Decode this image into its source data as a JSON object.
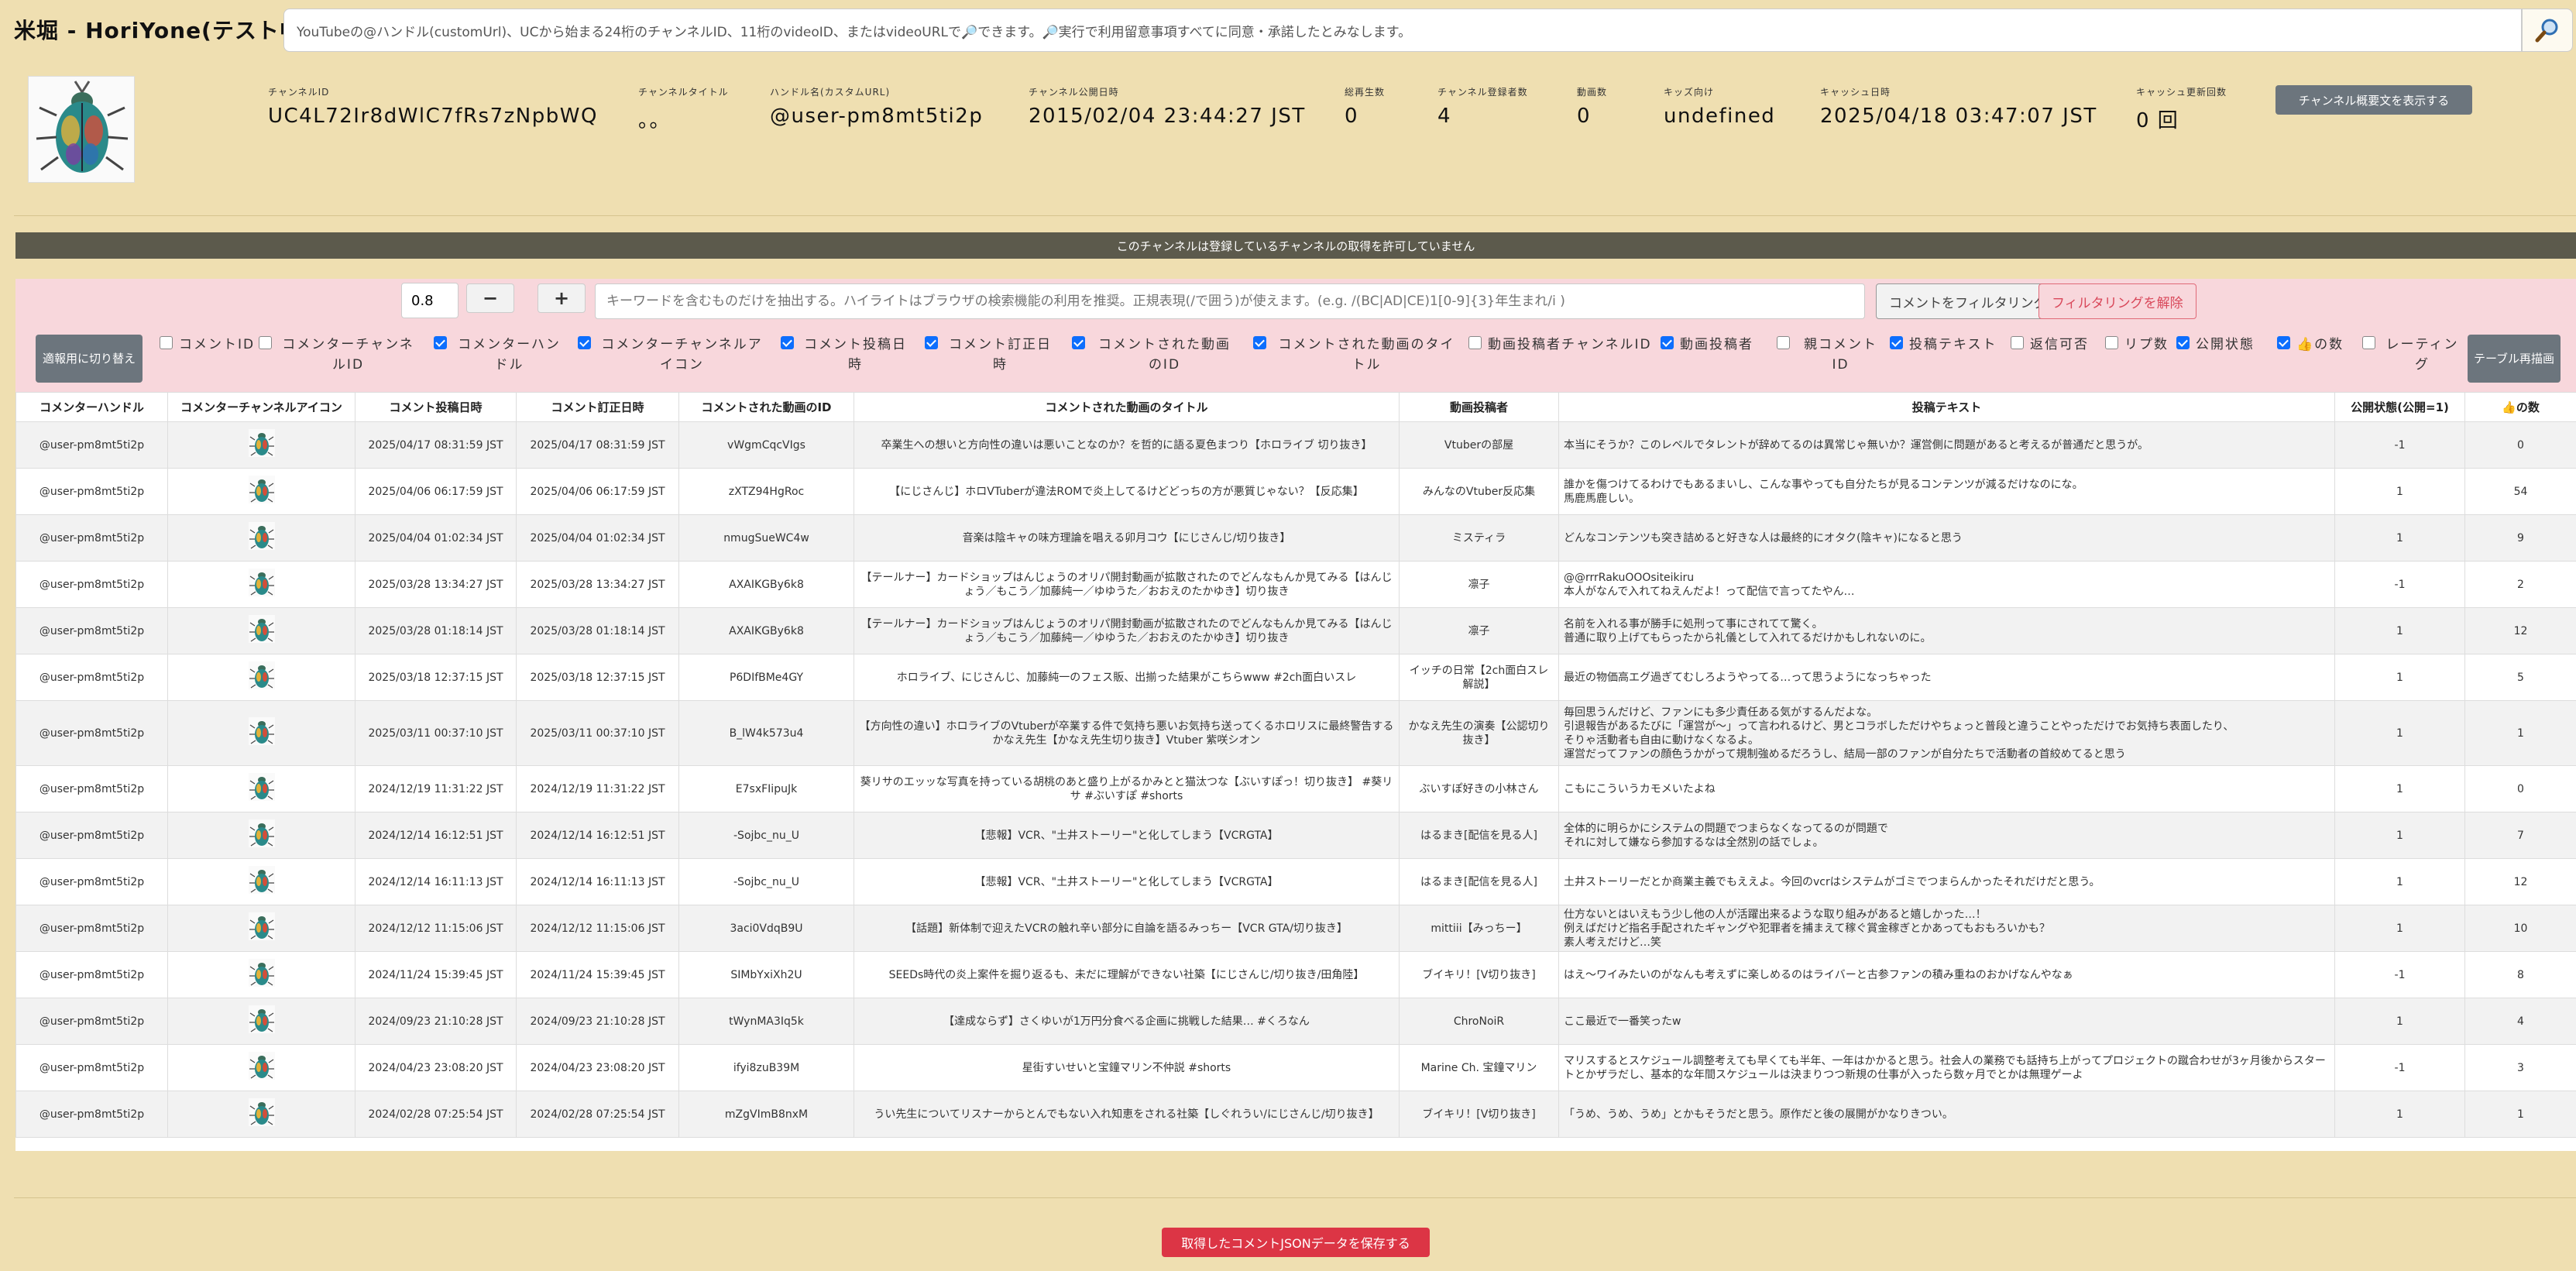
{
  "app": {
    "title": "米堀 - HoriYone(テスト中)"
  },
  "search": {
    "value": "YouTubeの@ハンドル(customUrl)、UCから始まる24桁のチャンネルID、11桁のvideoID、またはvideoURLで🔎できます。🔎実行で利用留意事項すべてに同意・承諾したとみなします。",
    "button_icon": "search-icon"
  },
  "channel": {
    "fields": [
      {
        "label": "チャンネルID",
        "value": "UC4L72Ir8dWlC7fRs7zNpbWQ"
      },
      {
        "label": "チャンネルタイトル",
        "value": "。。"
      },
      {
        "label": "ハンドル名(カスタムURL)",
        "value": "@user-pm8mt5ti2p"
      },
      {
        "label": "チャンネル公開日時",
        "value": "2015/02/04 23:44:27 JST"
      },
      {
        "label": "総再生数",
        "value": "0"
      },
      {
        "label": "チャンネル登録者数",
        "value": "4"
      },
      {
        "label": "動画数",
        "value": "0"
      },
      {
        "label": "キッズ向け",
        "value": "undefined"
      },
      {
        "label": "キャッシュ日時",
        "value": "2025/04/18 03:47:07 JST"
      },
      {
        "label": "キャッシュ更新回数",
        "value": "0 回"
      }
    ],
    "description_button": "チャンネル概要文を表示する"
  },
  "notice": "このチャンネルは登録しているチャンネルの取得を許可していません",
  "filter": {
    "threshold": "0.8",
    "minus_label": "−",
    "plus_label": "+",
    "keyword_placeholder": "キーワードを含むものだけを抽出する。ハイライトはブラウザの検索機能の利用を推奨。正規表現(/で囲う)が使えます。(e.g. /(BC|AD|CE)1[0-9]{3}年生まれ/i )",
    "filter_button": "コメントをフィルタリング",
    "clear_button": "フィルタリングを解除"
  },
  "controls": {
    "switch_button": "適報用に切り替え",
    "redraw_button": "テーブル再描画",
    "toggles": [
      {
        "label": "コメントID",
        "checked": false
      },
      {
        "label": "コメンターチャンネルID",
        "checked": false
      },
      {
        "label": "コメンターハンドル",
        "checked": true
      },
      {
        "label": "コメンターチャンネルアイコン",
        "checked": true
      },
      {
        "label": "コメント投稿日時",
        "checked": true
      },
      {
        "label": "コメント訂正日時",
        "checked": true
      },
      {
        "label": "コメントされた動画のID",
        "checked": true
      },
      {
        "label": "コメントされた動画のタイトル",
        "checked": true
      },
      {
        "label": "動画投稿者チャンネルID",
        "checked": false
      },
      {
        "label": "動画投稿者",
        "checked": true
      },
      {
        "label": "親コメントID",
        "checked": false
      },
      {
        "label": "投稿テキスト",
        "checked": true
      },
      {
        "label": "返信可否",
        "checked": false
      },
      {
        "label": "リプ数",
        "checked": false
      },
      {
        "label": "公開状態",
        "checked": true
      },
      {
        "label": "👍の数",
        "checked": true
      },
      {
        "label": "レーティング",
        "checked": false
      }
    ]
  },
  "table": {
    "headers": [
      "コメンターハンドル",
      "コメンターチャンネルアイコン",
      "コメント投稿日時",
      "コメント訂正日時",
      "コメントされた動画のID",
      "コメントされた動画のタイトル",
      "動画投稿者",
      "投稿テキスト",
      "公開状態(公開=1)",
      "👍の数"
    ],
    "rows": [
      {
        "handle": "@user-pm8mt5ti2p",
        "posted": "2025/04/17 08:31:59 JST",
        "edited": "2025/04/17 08:31:59 JST",
        "video_id": "vWgmCqcVIgs",
        "title": "卒業生への想いと方向性の違いは悪いことなのか？を哲的に語る夏色まつり【ホロライブ 切り抜き】",
        "uploader": "Vtuberの部屋",
        "text": "本当にそうか？このレベルでタレントが辞めてるのは異常じゃ無いか？運営側に問題があると考えるが普通だと思うが。",
        "status": "-1",
        "likes": "0"
      },
      {
        "handle": "@user-pm8mt5ti2p",
        "posted": "2025/04/06 06:17:59 JST",
        "edited": "2025/04/06 06:17:59 JST",
        "video_id": "zXTZ94HgRoc",
        "title": "【にじさんじ】ホロVTuberが違法ROMで炎上してるけどどっちの方が悪質じゃない？【反応集】",
        "uploader": "みんなのVtuber反応集",
        "text": "誰かを傷つけてるわけでもあるまいし、こんな事やっても自分たちが見るコンテンツが減るだけなのにな。\n馬鹿馬鹿しい。",
        "status": "1",
        "likes": "54"
      },
      {
        "handle": "@user-pm8mt5ti2p",
        "posted": "2025/04/04 01:02:34 JST",
        "edited": "2025/04/04 01:02:34 JST",
        "video_id": "nmugSueWC4w",
        "title": "音楽は陰キャの味方理論を唱える卯月コウ【にじさんじ/切り抜き】",
        "uploader": "ミスティラ",
        "text": "どんなコンテンツも突き詰めると好きな人は最終的にオタク(陰キャ)になると思う",
        "status": "1",
        "likes": "9"
      },
      {
        "handle": "@user-pm8mt5ti2p",
        "posted": "2025/03/28 13:34:27 JST",
        "edited": "2025/03/28 13:34:27 JST",
        "video_id": "AXAIKGBy6k8",
        "title": "【テールナー】カードショップはんじょうのオリパ開封動画が拡散されたのでどんなもんか見てみる【はんじょう／もこう／加藤純一／ゆゆうた／おおえのたかゆき】切り抜き",
        "uploader": "凛子",
        "text": "@@rrrRakuOOOsiteikiru\n本人がなんで入れてねえんだよ！って配信で言ってたやん…",
        "status": "-1",
        "likes": "2"
      },
      {
        "handle": "@user-pm8mt5ti2p",
        "posted": "2025/03/28 01:18:14 JST",
        "edited": "2025/03/28 01:18:14 JST",
        "video_id": "AXAIKGBy6k8",
        "title": "【テールナー】カードショップはんじょうのオリパ開封動画が拡散されたのでどんなもんか見てみる【はんじょう／もこう／加藤純一／ゆゆうた／おおえのたかゆき】切り抜き",
        "uploader": "凛子",
        "text": "名前を入れる事が勝手に処刑って事にされてて驚く。\n普通に取り上げてもらったから礼儀として入れてるだけかもしれないのに。",
        "status": "1",
        "likes": "12"
      },
      {
        "handle": "@user-pm8mt5ti2p",
        "posted": "2025/03/18 12:37:15 JST",
        "edited": "2025/03/18 12:37:15 JST",
        "video_id": "P6DIfBMe4GY",
        "title": "ホロライブ、にじさんじ、加藤純一のフェス販、出揃った結果がこちらwww #2ch面白いスレ",
        "uploader": "イッチの日常【2ch面白スレ解説】",
        "text": "最近の物価高エグ過ぎてむしろようやってる…って思うようになっちゃった",
        "status": "1",
        "likes": "5"
      },
      {
        "handle": "@user-pm8mt5ti2p",
        "posted": "2025/03/11 00:37:10 JST",
        "edited": "2025/03/11 00:37:10 JST",
        "video_id": "B_lW4k573u4",
        "title": "【方向性の違い】ホロライブのVtuberが卒業する件で気持ち悪いお気持ち送ってくるホロリスに最終警告するかなえ先生【かなえ先生切り抜き】Vtuber 紫咲シオン",
        "uploader": "かなえ先生の演奏【公認切り抜き】",
        "text": "毎回思うんだけど、ファンにも多少責任ある気がするんだよな。\n引退報告があるたびに「運営が～」って言われるけど、男とコラボしただけやちょっと普段と違うことやっただけでお気持ち表面したり、\nそりゃ活動者も自由に動けなくなるよ。\n運営だってファンの顔色うかがって規制強めるだろうし、結局一部のファンが自分たちで活動者の首絞めてると思う",
        "status": "1",
        "likes": "1"
      },
      {
        "handle": "@user-pm8mt5ti2p",
        "posted": "2024/12/19 11:31:22 JST",
        "edited": "2024/12/19 11:31:22 JST",
        "video_id": "E7sxFIipuJk",
        "title": "葵リサのエッッな写真を持っている胡桃のあと盛り上がるかみとと猫汰つな【ぶいすぽっ！切り抜き】 #葵リサ #ぶいすぽ #shorts",
        "uploader": "ぶいすぽ好きの小林さん",
        "text": "こもにこういうカモメいたよね",
        "status": "1",
        "likes": "0"
      },
      {
        "handle": "@user-pm8mt5ti2p",
        "posted": "2024/12/14 16:12:51 JST",
        "edited": "2024/12/14 16:12:51 JST",
        "video_id": "-Sojbc_nu_U",
        "title": "【悲報】VCR、\"土井ストーリー\"と化してしまう【VCRGTA】",
        "uploader": "はるまき[配信を見る人]",
        "text": "全体的に明らかにシステムの問題でつまらなくなってるのが問題で\nそれに対して嫌なら参加するなは全然別の話でしょ。",
        "status": "1",
        "likes": "7"
      },
      {
        "handle": "@user-pm8mt5ti2p",
        "posted": "2024/12/14 16:11:13 JST",
        "edited": "2024/12/14 16:11:13 JST",
        "video_id": "-Sojbc_nu_U",
        "title": "【悲報】VCR、\"土井ストーリー\"と化してしまう【VCRGTA】",
        "uploader": "はるまき[配信を見る人]",
        "text": "土井ストーリーだとか商業主義でもええよ。今回のvcrはシステムがゴミでつまらんかったそれだけだと思う。",
        "status": "1",
        "likes": "12"
      },
      {
        "handle": "@user-pm8mt5ti2p",
        "posted": "2024/12/12 11:15:06 JST",
        "edited": "2024/12/12 11:15:06 JST",
        "video_id": "3aci0VdqB9U",
        "title": "【話題】新体制で迎えたVCRの触れ辛い部分に自論を語るみっちー【VCR GTA/切り抜き】",
        "uploader": "mittiii【みっちー】",
        "text": "仕方ないとはいえもう少し他の人が活躍出来るような取り組みがあると嬉しかった…！\n例えばだけど指名手配されたギャングや犯罪者を捕まえて稼ぐ賞金稼ぎとかあってもおもろいかも？\n素人考えだけど…笑",
        "status": "1",
        "likes": "10"
      },
      {
        "handle": "@user-pm8mt5ti2p",
        "posted": "2024/11/24 15:39:45 JST",
        "edited": "2024/11/24 15:39:45 JST",
        "video_id": "SIMbYxiXh2U",
        "title": "SEEDs時代の炎上案件を掘り返るも、未だに理解ができない社築【にじさんじ/切り抜き/田角陸】",
        "uploader": "ブイキリ！[V切り抜き]",
        "text": "はえ～ワイみたいのがなんも考えずに楽しめるのはライバーと古参ファンの積み重ねのおかげなんやなぁ",
        "status": "-1",
        "likes": "8"
      },
      {
        "handle": "@user-pm8mt5ti2p",
        "posted": "2024/09/23 21:10:28 JST",
        "edited": "2024/09/23 21:10:28 JST",
        "video_id": "tWynMA3Iq5k",
        "title": "【達成ならず】さくゆいが1万円分食べる企画に挑戦した結果… #くろなん",
        "uploader": "ChroNoiR",
        "text": "ここ最近で一番笑ったw",
        "status": "1",
        "likes": "4"
      },
      {
        "handle": "@user-pm8mt5ti2p",
        "posted": "2024/04/23 23:08:20 JST",
        "edited": "2024/04/23 23:08:20 JST",
        "video_id": "ifyi8zuB39M",
        "title": "星街すいせいと宝鐘マリン不仲説 #shorts",
        "uploader": "Marine Ch. 宝鐘マリン",
        "text": "マリスするとスケジュール調整考えても早くても半年、一年はかかると思う。社会人の業務でも話持ち上がってプロジェクトの蹴合わせが3ヶ月後からスタートとかザラだし、基本的な年間スケジュールは決まりつつ新規の仕事が入ったら数ヶ月でとかは無理ゲーよ",
        "status": "-1",
        "likes": "3"
      },
      {
        "handle": "@user-pm8mt5ti2p",
        "posted": "2024/02/28 07:25:54 JST",
        "edited": "2024/02/28 07:25:54 JST",
        "video_id": "mZgVImB8nxM",
        "title": "うい先生についてリスナーからとんでもない入れ知恵をされる社築【しぐれうい/にじさんじ/切り抜き】",
        "uploader": "ブイキリ！[V切り抜き]",
        "text": "「うめ、うめ、うめ」とかもそうだと思う。原作だと後の展開がかなりきつい。",
        "status": "1",
        "likes": "1"
      }
    ]
  },
  "save_button": "取得したコメントJSONデータを保存する"
}
